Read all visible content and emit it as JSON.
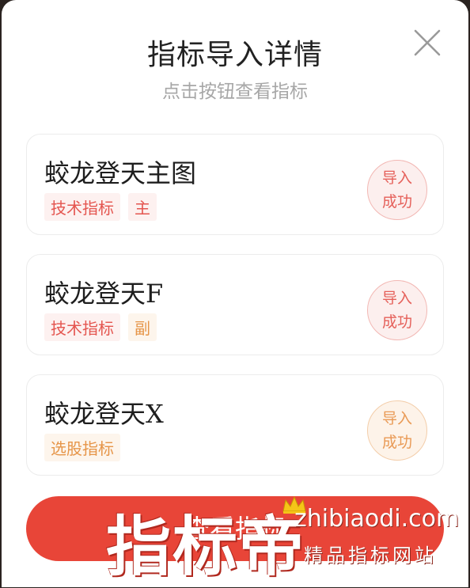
{
  "modal": {
    "title": "指标导入详情",
    "subtitle": "点击按钮查看指标",
    "close_icon": "close-icon"
  },
  "cards": [
    {
      "title": "蛟龙登天主图",
      "tags": [
        {
          "label": "技术指标",
          "color": "#e4554f"
        },
        {
          "label": "主",
          "color": "#e4554f"
        }
      ],
      "status_line1": "导入",
      "status_line2": "成功",
      "status_color": "#e5605a"
    },
    {
      "title": "蛟龙登天F",
      "tags": [
        {
          "label": "技术指标",
          "color": "#e4554f"
        },
        {
          "label": "副",
          "color": "#e69548"
        }
      ],
      "status_line1": "导入",
      "status_line2": "成功",
      "status_color": "#e5605a"
    },
    {
      "title": "蛟龙登天X",
      "tags": [
        {
          "label": "选股指标",
          "color": "#e69548"
        }
      ],
      "status_line1": "导入",
      "status_line2": "成功",
      "status_color": "#e99a55"
    }
  ],
  "button": {
    "label": "查看指标",
    "color": "#e84538"
  },
  "watermark": {
    "big": "指标帝",
    "site": "zhibiaodi.com",
    "slogan": "精品指标网站",
    "crown_icon": "crown-icon"
  }
}
